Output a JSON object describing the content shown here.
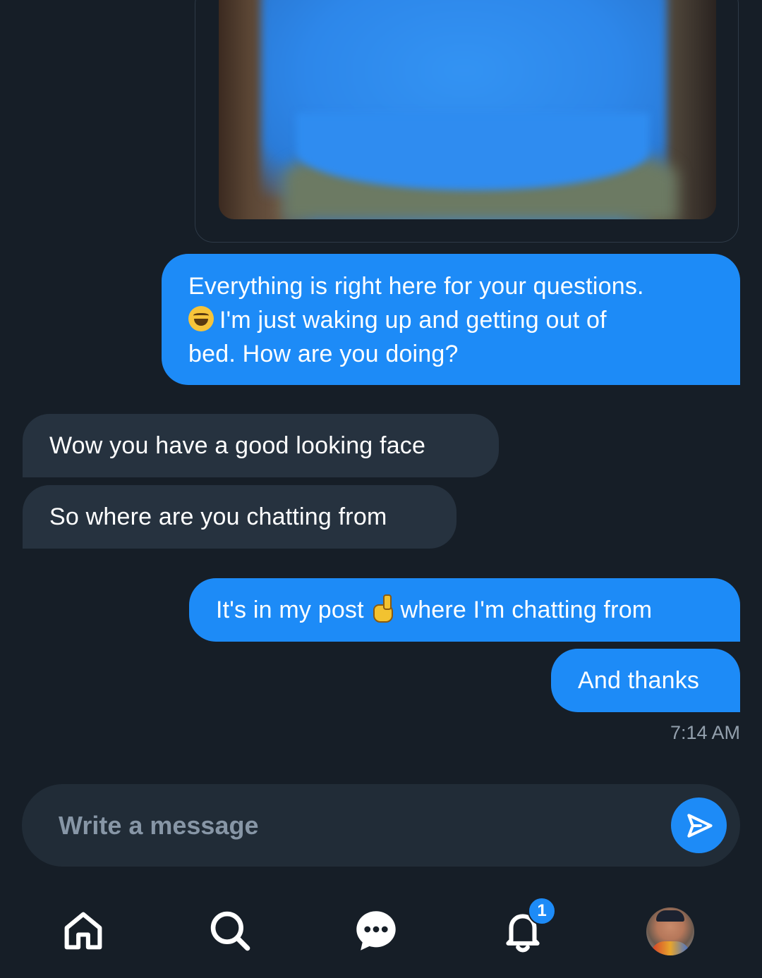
{
  "messages": {
    "out_1_line1": "Everything is right here for your questions.",
    "out_1_line2": "I'm just waking up and getting out of",
    "out_1_line3": "bed. How are you doing?",
    "in_1": "Wow you have a good looking face",
    "in_2": "So where are you chatting from",
    "out_2_part1": "It's in my post",
    "out_2_part2": "where I'm chatting from",
    "out_3": "And thanks",
    "timestamp": "7:14 AM"
  },
  "composer": {
    "placeholder": "Write a message"
  },
  "nav": {
    "notification_count": "1",
    "items": [
      "home-icon",
      "search-icon",
      "messages-icon",
      "notifications-icon",
      "profile-avatar"
    ]
  },
  "colors": {
    "background": "#161e27",
    "outgoing_bubble": "#1d8bf7",
    "incoming_bubble": "#26323f",
    "composer": "#212c37",
    "accent": "#1d8bf7"
  }
}
